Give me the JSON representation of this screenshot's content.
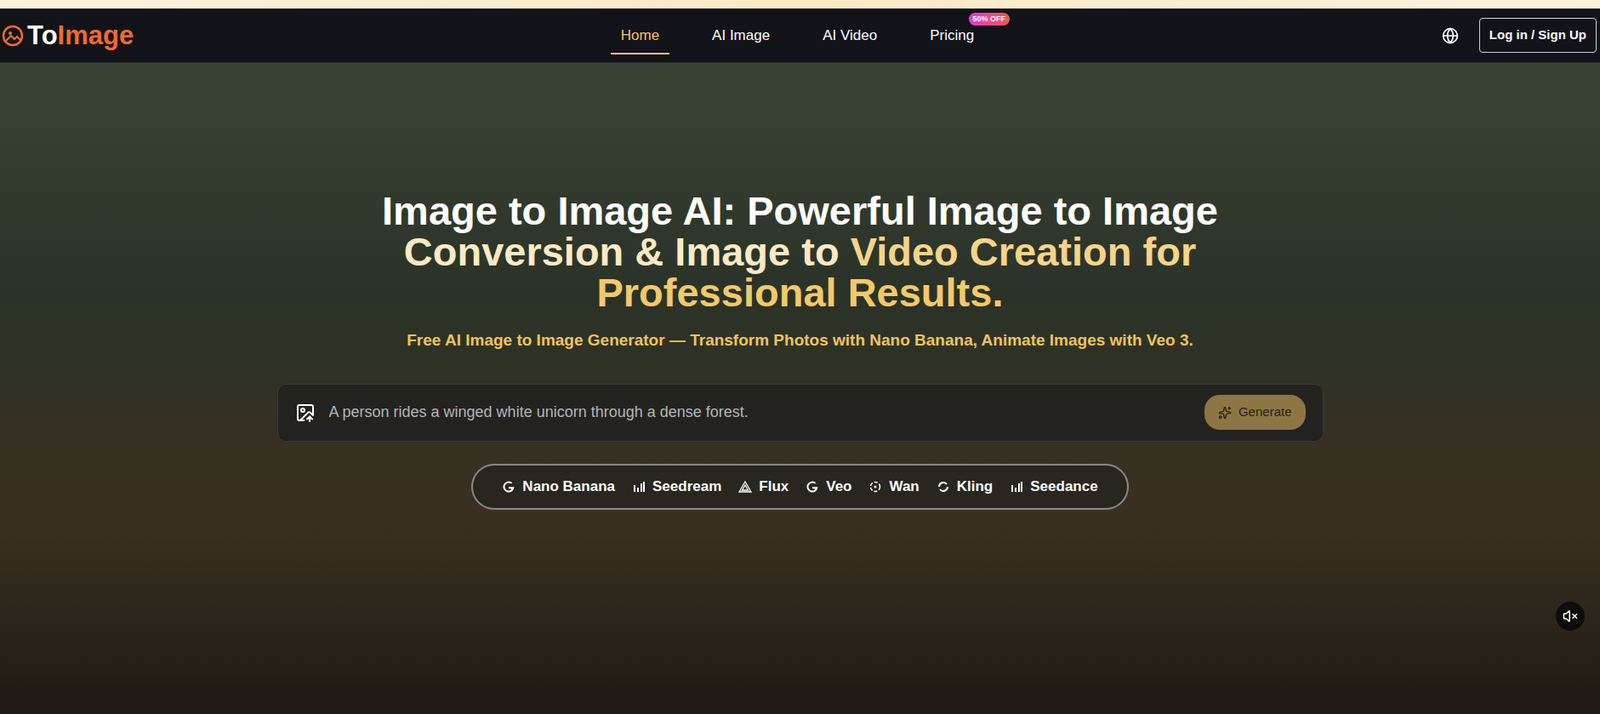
{
  "logo": {
    "segments": [
      {
        "text": "To",
        "color": "#ffffff"
      },
      {
        "text": "Image",
        "color": "#f26b2d"
      }
    ]
  },
  "nav": {
    "items": [
      {
        "label": "Home",
        "selected": true
      },
      {
        "label": "AI Image",
        "selected": false
      },
      {
        "label": "AI Video",
        "selected": false
      },
      {
        "label": "Pricing",
        "selected": false,
        "badge": "50% OFF"
      }
    ]
  },
  "login_button": "Log in / Sign Up",
  "hero": {
    "heading_lines": [
      [
        {
          "text": "Image to Image AI: Powerful Image to Image",
          "color": "#ffffff"
        }
      ],
      [
        {
          "text": "Conversion & Image to ",
          "color": "#fbeac4"
        },
        {
          "text": "Video Creation for",
          "color": "#f6d488"
        }
      ],
      [
        {
          "text": "Professional Results.",
          "color": "#f2c96a"
        }
      ]
    ],
    "subtitle": "Free AI Image to Image Generator — Transform Photos with Nano Banana, Animate Images with Veo 3.",
    "prompt": {
      "placeholder": "A person rides a winged white unicorn through a dense forest."
    },
    "generate_button": "Generate",
    "models": [
      {
        "label": "Nano Banana",
        "kind": "google"
      },
      {
        "label": "Seedream",
        "kind": "bars"
      },
      {
        "label": "Flux",
        "kind": "flux"
      },
      {
        "label": "Veo",
        "kind": "google"
      },
      {
        "label": "Wan",
        "kind": "wan"
      },
      {
        "label": "Kling",
        "kind": "kling"
      },
      {
        "label": "Seedance",
        "kind": "bars"
      }
    ],
    "muted": true
  }
}
